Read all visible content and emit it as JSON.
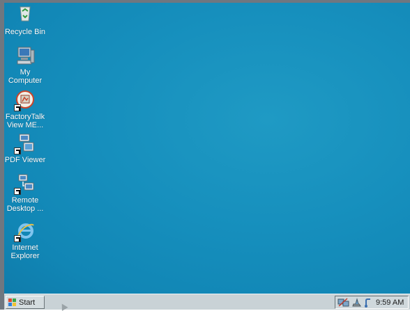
{
  "desktop": {
    "icons": [
      {
        "label": "Recycle Bin",
        "icon": "recycle-bin-icon"
      },
      {
        "label": "My\nComputer",
        "icon": "my-computer-icon"
      },
      {
        "label": "FactoryTalk\nView ME...",
        "icon": "factorytalk-icon"
      },
      {
        "label": "PDF Viewer",
        "icon": "pdf-viewer-icon"
      },
      {
        "label": "Remote\nDesktop ...",
        "icon": "remote-desktop-icon"
      },
      {
        "label": "Internet\nExplorer",
        "icon": "internet-explorer-icon"
      }
    ],
    "background_color": "#168fbd"
  },
  "taskbar": {
    "start_label": "Start",
    "clock": "9:59 AM",
    "tray_icons": [
      "network-icon",
      "speaker-icon",
      "keyboard-icon"
    ]
  }
}
